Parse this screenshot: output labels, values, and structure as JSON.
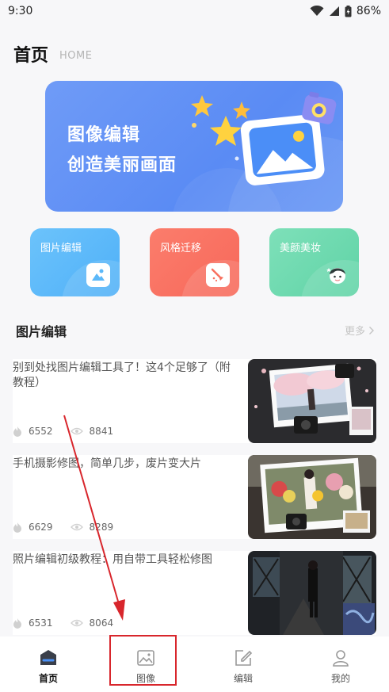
{
  "status_bar": {
    "time": "9:30",
    "battery": "86%"
  },
  "header": {
    "title": "首页",
    "subtitle": "HOME"
  },
  "banner": {
    "line1": "图像编辑",
    "line2": "创造美丽画面"
  },
  "features": [
    {
      "label": "图片编辑",
      "icon": "image-icon",
      "color": "#5bb8f9"
    },
    {
      "label": "风格迁移",
      "icon": "brush-icon",
      "color": "#f8705f"
    },
    {
      "label": "美颜美妆",
      "icon": "face-icon",
      "color": "#6cd9ae"
    }
  ],
  "section": {
    "title": "图片编辑",
    "more": "更多"
  },
  "articles": [
    {
      "title": "别到处找图片编辑工具了！这4个足够了（附教程）",
      "likes": "6552",
      "views": "8841"
    },
    {
      "title": "手机摄影修图，简单几步，废片变大片",
      "likes": "6629",
      "views": "8289"
    },
    {
      "title": "照片编辑初级教程：用自带工具轻松修图",
      "likes": "6531",
      "views": "8064"
    }
  ],
  "tabbar": [
    {
      "label": "首页",
      "icon": "home-icon",
      "active": true
    },
    {
      "label": "图像",
      "icon": "image-icon",
      "active": false
    },
    {
      "label": "编辑",
      "icon": "edit-icon",
      "active": false
    },
    {
      "label": "我的",
      "icon": "user-icon",
      "active": false
    }
  ],
  "annotation": {
    "color": "#d8262c",
    "target": "图像"
  }
}
